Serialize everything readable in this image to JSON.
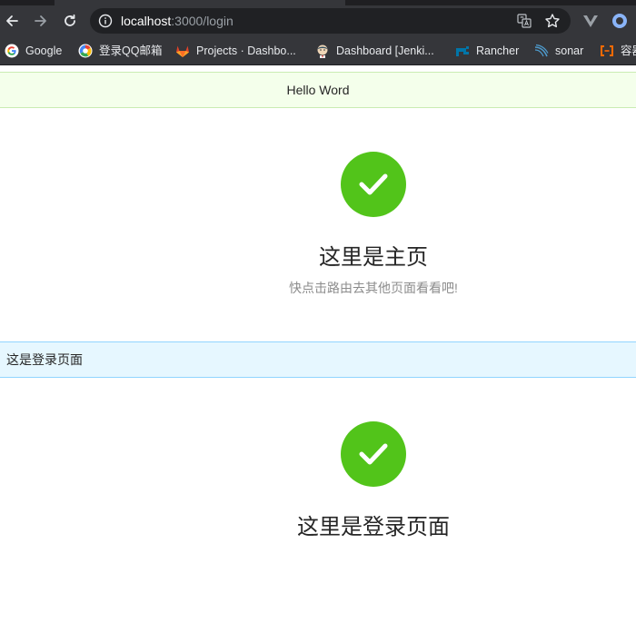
{
  "browser": {
    "url_host": "localhost",
    "url_path": ":3000/login",
    "bookmarks": [
      {
        "label": "Google",
        "icon": "google-icon"
      },
      {
        "label": "登录QQ邮箱",
        "icon": "qq-mail-icon"
      },
      {
        "label": "Projects · Dashbo...",
        "icon": "gitlab-icon"
      },
      {
        "label": "Dashboard [Jenki...",
        "icon": "jenkins-icon"
      },
      {
        "label": "Rancher",
        "icon": "rancher-icon"
      },
      {
        "label": "sonar",
        "icon": "sonar-icon"
      },
      {
        "label": "容器",
        "icon": "aliyun-icon"
      }
    ]
  },
  "header": {
    "text": "Hello Word"
  },
  "home_result": {
    "title": "这里是主页",
    "subtitle": "快点击路由去其他页面看看吧!"
  },
  "login_notice": {
    "text": "这是登录页面"
  },
  "login_result": {
    "title": "这里是登录页面"
  },
  "colors": {
    "success": "#52c41a",
    "header_bg": "#f4ffeb",
    "info_bg": "#e6f7ff"
  }
}
